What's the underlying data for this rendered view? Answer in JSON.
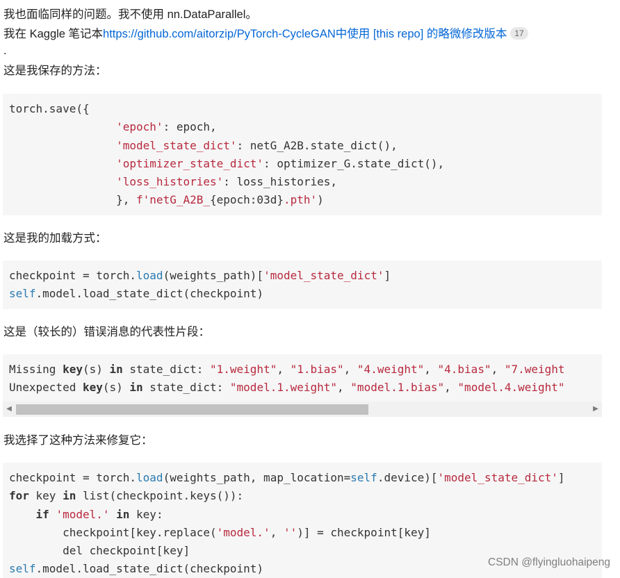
{
  "para1": "我也面临同样的问题。我不使用 nn.DataParallel。",
  "para2": {
    "prefix": "我在 Kaggle 笔记本",
    "link": "https://github.com/aitorzip/PyTorch-CycleGAN中使用 [this repo] 的略微修改版本",
    "badge": "17",
    "tail": "."
  },
  "para3": "这是我保存的方法：",
  "para4": "这是我的加载方式：",
  "para5": "这是（较长的）错误消息的代表性片段：",
  "para6": "我选择了这种方法来修复它：",
  "code_save": {
    "l1": "torch.save({",
    "indent": "                ",
    "k1": "'epoch'",
    "v1": ": epoch,",
    "k2": "'model_state_dict'",
    "v2": ": netG_A2B.state_dict(),",
    "k3": "'optimizer_state_dict'",
    "v3": ": optimizer_G.state_dict(),",
    "k4": "'loss_histories'",
    "v4": ": loss_histories,",
    "l6a": "}, ",
    "l6b": "f'netG_A2B_",
    "l6c": "{epoch:03d}",
    "l6d": ".pth'",
    "l6e": ")"
  },
  "code_load": {
    "l1a": "checkpoint = torch.",
    "l1b": "load",
    "l1c": "(weights_path)[",
    "l1d": "'model_state_dict'",
    "l1e": "]",
    "l2a": "self",
    "l2b": ".model.load_state_dict(checkpoint)"
  },
  "code_error": {
    "l1a": "Missing ",
    "l1b": "key",
    "l1c": "(s) ",
    "l1d": "in",
    "l1e": " state_dict: ",
    "l1f": "\"1.weight\"",
    "l1g": ", ",
    "l1h": "\"1.bias\"",
    "l1i": ", ",
    "l1j": "\"4.weight\"",
    "l1k": ", ",
    "l1l": "\"4.bias\"",
    "l1m": ", ",
    "l1n": "\"7.weight",
    "l2a": "Unexpected ",
    "l2b": "key",
    "l2c": "(s) ",
    "l2d": "in",
    "l2e": " state_dict: ",
    "l2f": "\"model.1.weight\"",
    "l2g": ", ",
    "l2h": "\"model.1.bias\"",
    "l2i": ", ",
    "l2j": "\"model.4.weight\""
  },
  "code_fix": {
    "l1a": "checkpoint = torch.",
    "l1b": "load",
    "l1c": "(weights_path, map_location=",
    "l1d": "self",
    "l1e": ".device)[",
    "l1f": "'model_state_dict'",
    "l1g": "]",
    "l2a": "for",
    "l2b": " key ",
    "l2c": "in",
    "l2d": " list(checkpoint.keys()):",
    "l3a": "    ",
    "l3b": "if",
    "l3c": " ",
    "l3d": "'model.'",
    "l3e": " ",
    "l3f": "in",
    "l3g": " key:",
    "l4a": "        checkpoint[key.replace(",
    "l4b": "'model.'",
    "l4c": ", ",
    "l4d": "''",
    "l4e": ")] = checkpoint[key]",
    "l5": "        del checkpoint[key]",
    "l6a": "self",
    "l6b": ".model.load_state_dict(checkpoint)"
  },
  "scrollbar": {
    "left_arrow": "◀",
    "right_arrow": "▶"
  },
  "watermark": "CSDN @flyingluohaipeng"
}
